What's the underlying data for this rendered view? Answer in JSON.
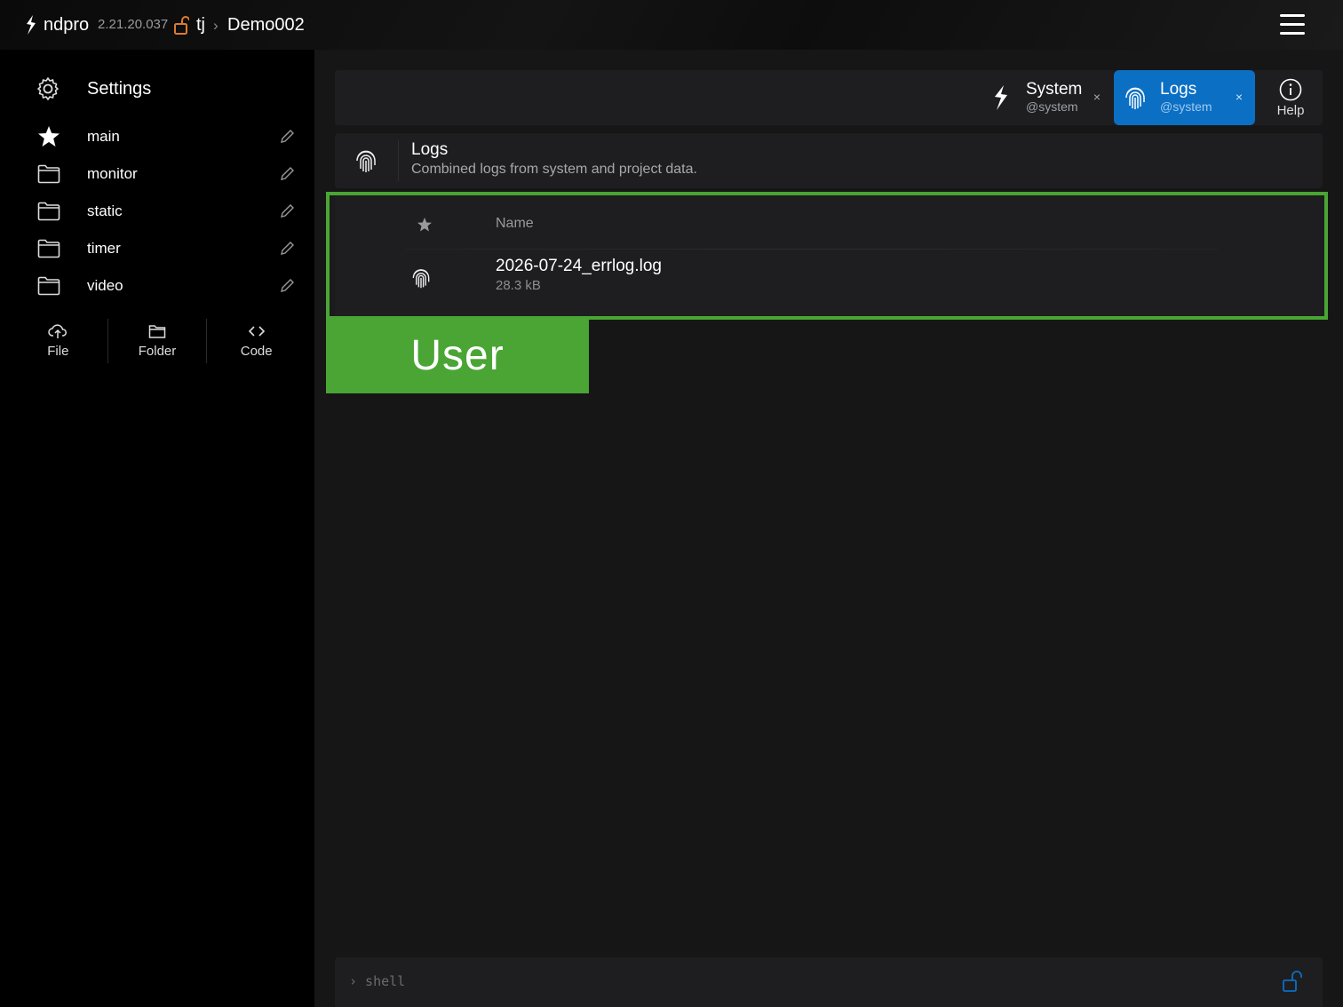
{
  "topbar": {
    "brand": "ndpro",
    "version": "2.21.20.037",
    "user": "tj",
    "separator": "›",
    "project": "Demo002"
  },
  "sidebar": {
    "settings_label": "Settings",
    "items": [
      {
        "label": "main",
        "icon": "star-icon"
      },
      {
        "label": "monitor",
        "icon": "folder-icon"
      },
      {
        "label": "static",
        "icon": "folder-icon"
      },
      {
        "label": "timer",
        "icon": "folder-icon"
      },
      {
        "label": "video",
        "icon": "folder-icon"
      }
    ],
    "actions": [
      {
        "label": "File",
        "icon": "upload-cloud-icon"
      },
      {
        "label": "Folder",
        "icon": "folder-icon"
      },
      {
        "label": "Code",
        "icon": "code-icon"
      }
    ]
  },
  "tabs": [
    {
      "name": "System",
      "sub": "@system",
      "close": "×",
      "active": false
    },
    {
      "name": "Logs",
      "sub": "@system",
      "close": "×",
      "active": true
    }
  ],
  "help_label": "Help",
  "panel": {
    "title": "Logs",
    "description": "Combined logs from system and project data."
  },
  "filelist": {
    "column_name": "Name",
    "rows": [
      {
        "name": "2026-07-24_errlog.log",
        "size": "28.3 kB"
      }
    ]
  },
  "badge": "User",
  "shell": {
    "prompt": "› shell"
  },
  "colors": {
    "accent_blue": "#0b6fc4",
    "highlight_green": "#4aa535",
    "lock_orange": "#e07a2e"
  }
}
